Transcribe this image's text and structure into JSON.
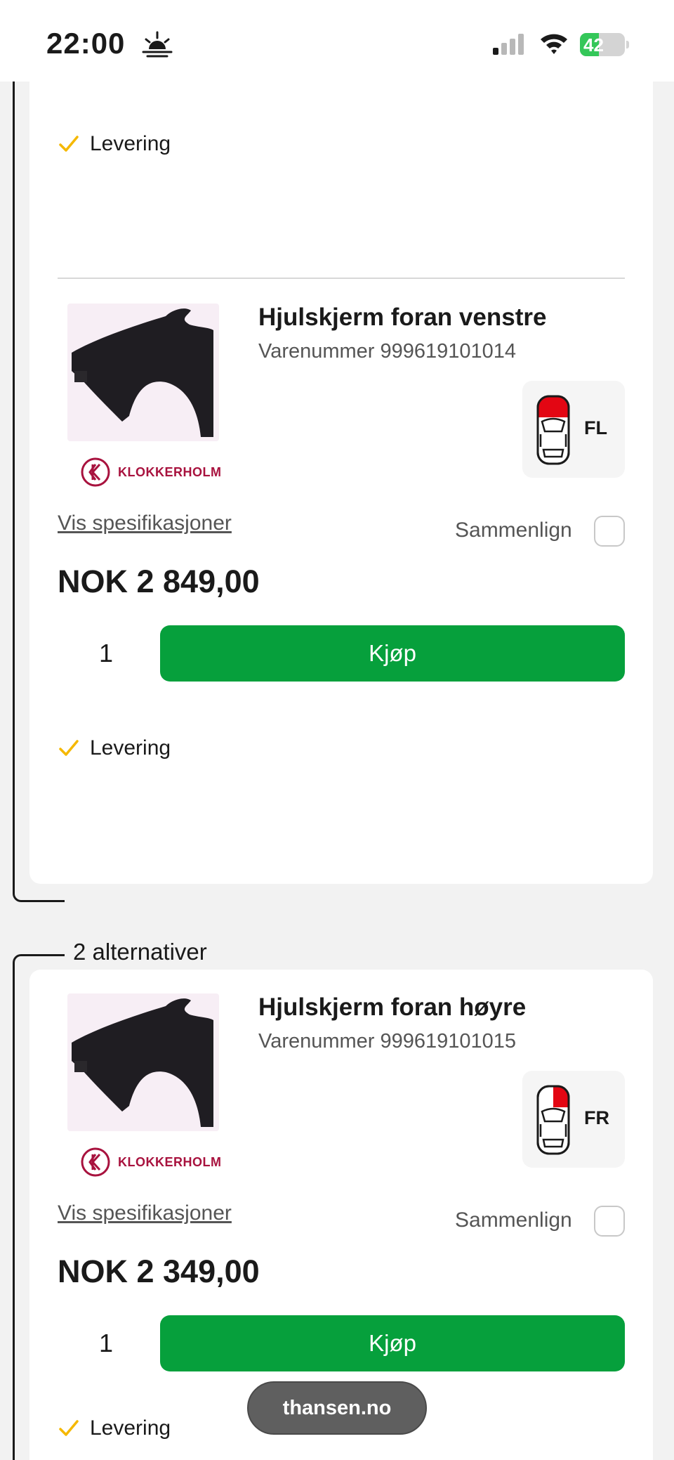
{
  "status_bar": {
    "time": "22:00",
    "battery": "42",
    "battery_level": 0.42
  },
  "group2_label": "2 alternativer",
  "delivery_label": "Levering",
  "products": [
    {
      "title": "Hjulskjerm foran venstre",
      "sku": "Varenummer 999619101014",
      "brand": "KLOKKERHOLM",
      "position_code": "FL",
      "spec_link": "Vis spesifikasjoner",
      "compare_label": "Sammenlign",
      "price": "NOK 2 849,00",
      "quantity": "1",
      "buy_label": "Kjøp"
    },
    {
      "title": "Hjulskjerm foran høyre",
      "sku": "Varenummer 999619101015",
      "brand": "KLOKKERHOLM",
      "position_code": "FR",
      "spec_link": "Vis spesifikasjoner",
      "compare_label": "Sammenlign",
      "price": "NOK 2 349,00",
      "quantity": "1",
      "buy_label": "Kjøp"
    }
  ],
  "site_pill": "thansen.no",
  "colors": {
    "buy_button": "#06a03c",
    "check": "#f5b800",
    "brand": "#a8123e",
    "position_highlight": "#e30613"
  }
}
